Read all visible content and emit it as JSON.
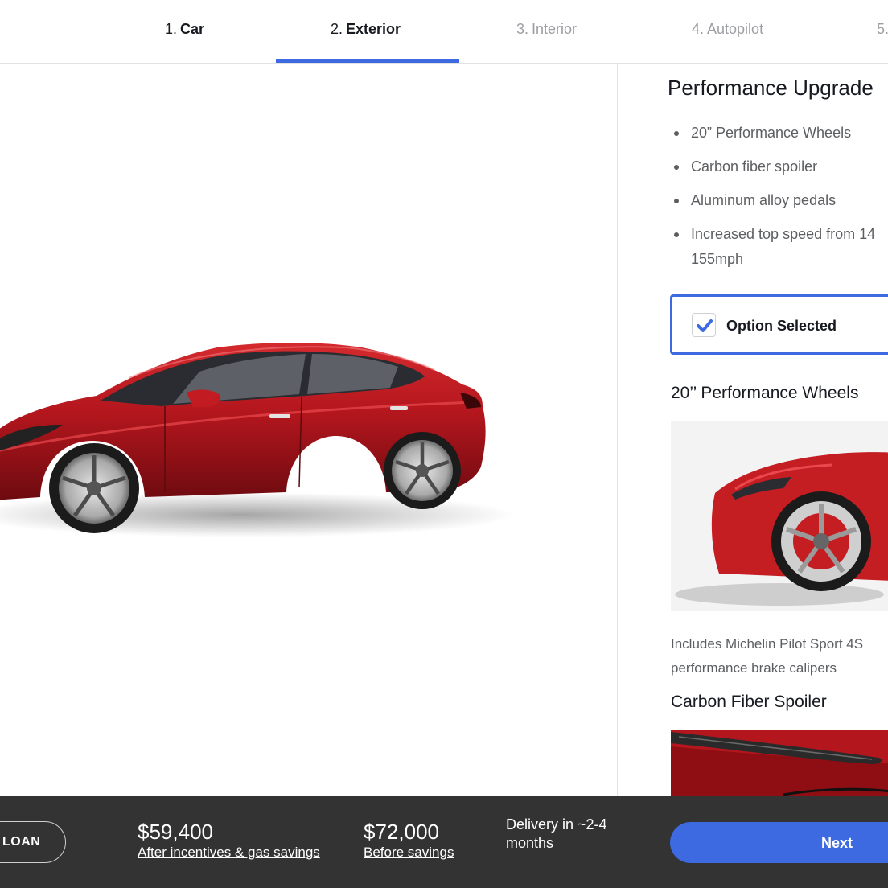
{
  "steps": [
    {
      "num": "1.",
      "label": "Car"
    },
    {
      "num": "2.",
      "label": "Exterior"
    },
    {
      "num": "3.",
      "label": "Interior"
    },
    {
      "num": "4.",
      "label": "Autopilot"
    },
    {
      "num": "5.",
      "label": ""
    }
  ],
  "panel": {
    "title": "Performance Upgrade",
    "features": [
      "20” Performance Wheels",
      "Carbon fiber spoiler",
      "Aluminum alloy pedals",
      "Increased top speed from 14 155mph"
    ],
    "option_label": "Option Selected",
    "wheels_title": "20’’ Performance Wheels",
    "wheels_desc": "Includes Michelin Pilot Sport 4S performance brake calipers",
    "spoiler_title": "Carbon Fiber Spoiler"
  },
  "bottom": {
    "loan_label": "LOAN",
    "price_after": "$59,400",
    "price_after_note": "After incentives & gas savings",
    "price_before": "$72,000",
    "price_before_note": "Before savings",
    "delivery": "Delivery in ~2-4 months",
    "next_label": "Next"
  },
  "colors": {
    "accent": "#3e6ae1",
    "car_red": "#b3161d",
    "bottom_bar": "#333333"
  }
}
